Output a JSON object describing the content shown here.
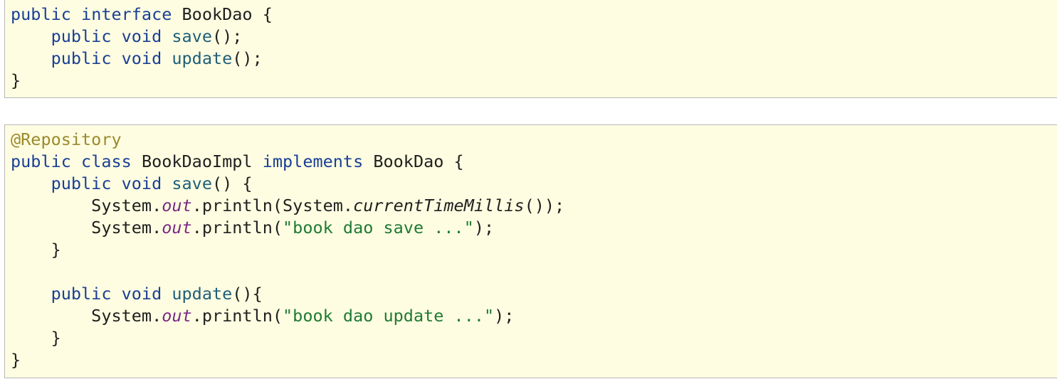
{
  "block1": {
    "lines": [
      [
        {
          "t": "public",
          "c": "kw"
        },
        {
          "t": " "
        },
        {
          "t": "interface",
          "c": "kw"
        },
        {
          "t": " BookDao {"
        }
      ],
      [
        {
          "t": "    "
        },
        {
          "t": "public",
          "c": "kw"
        },
        {
          "t": " "
        },
        {
          "t": "void",
          "c": "kw"
        },
        {
          "t": " "
        },
        {
          "t": "save",
          "c": "fn"
        },
        {
          "t": "();"
        }
      ],
      [
        {
          "t": "    "
        },
        {
          "t": "public",
          "c": "kw"
        },
        {
          "t": " "
        },
        {
          "t": "void",
          "c": "kw"
        },
        {
          "t": " "
        },
        {
          "t": "update",
          "c": "fn"
        },
        {
          "t": "();"
        }
      ],
      [
        {
          "t": "}"
        }
      ]
    ]
  },
  "block2": {
    "lines": [
      [
        {
          "t": "@Repository",
          "c": "ann"
        }
      ],
      [
        {
          "t": "public",
          "c": "kw"
        },
        {
          "t": " "
        },
        {
          "t": "class",
          "c": "kw"
        },
        {
          "t": " BookDaoImpl "
        },
        {
          "t": "implements",
          "c": "kw"
        },
        {
          "t": " BookDao {"
        }
      ],
      [
        {
          "t": "    "
        },
        {
          "t": "public",
          "c": "kw"
        },
        {
          "t": " "
        },
        {
          "t": "void",
          "c": "kw"
        },
        {
          "t": " "
        },
        {
          "t": "save",
          "c": "fn"
        },
        {
          "t": "() {"
        }
      ],
      [
        {
          "t": "        System."
        },
        {
          "t": "out",
          "c": "fld"
        },
        {
          "t": ".println(System."
        },
        {
          "t": "currentTimeMillis",
          "c": "sm"
        },
        {
          "t": "());"
        }
      ],
      [
        {
          "t": "        System."
        },
        {
          "t": "out",
          "c": "fld"
        },
        {
          "t": ".println("
        },
        {
          "t": "\"book dao save ...\"",
          "c": "st"
        },
        {
          "t": ");"
        }
      ],
      [
        {
          "t": "    }"
        }
      ],
      [],
      [
        {
          "t": "    "
        },
        {
          "t": "public",
          "c": "kw"
        },
        {
          "t": " "
        },
        {
          "t": "void",
          "c": "kw"
        },
        {
          "t": " "
        },
        {
          "t": "update",
          "c": "fn"
        },
        {
          "t": "(){"
        }
      ],
      [
        {
          "t": "        System."
        },
        {
          "t": "out",
          "c": "fld"
        },
        {
          "t": ".println("
        },
        {
          "t": "\"book dao update ...\"",
          "c": "st"
        },
        {
          "t": ");"
        }
      ],
      [
        {
          "t": "    }"
        }
      ],
      [
        {
          "t": "}"
        }
      ]
    ]
  }
}
